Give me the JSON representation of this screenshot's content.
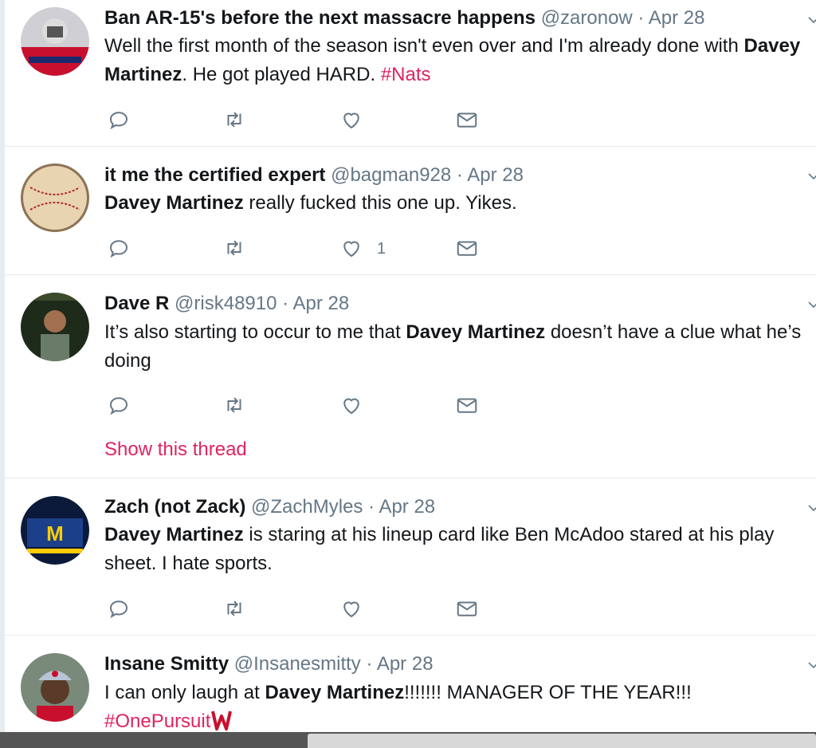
{
  "tweets": [
    {
      "name": "Ban AR-15's before the next massacre happens",
      "handle": "@zaronow",
      "sep": " · ",
      "date": "Apr 28",
      "body": {
        "p1": "Well the first month of the season isn't even over and I'm already done with ",
        "bold": "Davey Martinez",
        "p2": ". He got played HARD. ",
        "hashtag": "#Nats"
      }
    },
    {
      "name": "it me the certified expert",
      "handle": "@bagman928",
      "sep": " · ",
      "date": "Apr 28",
      "body": {
        "bold": "Davey Martinez",
        "p2": " really fucked this one up. Yikes."
      },
      "like_count": "1"
    },
    {
      "name": "Dave R",
      "handle": "@risk48910",
      "sep": " · ",
      "date": "Apr 28",
      "body": {
        "p1": "It’s also starting to occur to me that ",
        "bold": "Davey Martinez",
        "p2": " doesn’t have a clue what he’s doing"
      },
      "thread_link": "Show this thread"
    },
    {
      "name": "Zach (not Zack)",
      "handle": "@ZachMyles",
      "sep": " · ",
      "date": "Apr 28",
      "body": {
        "bold": "Davey Martinez",
        "p2": " is staring at his lineup card like Ben McAdoo stared at his play sheet. I hate sports."
      }
    },
    {
      "name": "Insane Smitty",
      "handle": "@Insanesmitty",
      "sep": " · ",
      "date": "Apr 28",
      "body": {
        "p1": "I can only laugh at ",
        "bold": "Davey Martinez",
        "p2": "!!!!!!! MANAGER OF THE YEAR!!!",
        "hashtag": "#OnePursuit"
      }
    }
  ],
  "icons": [
    "reply-icon",
    "retweet-icon",
    "like-icon",
    "direct-message-icon",
    "chevron-down-icon",
    "nationals-logo-icon"
  ],
  "colors": {
    "hashtag": "#e0245e",
    "handle": "#657786",
    "icon": "#657786",
    "divider": "#e6ecf0"
  }
}
